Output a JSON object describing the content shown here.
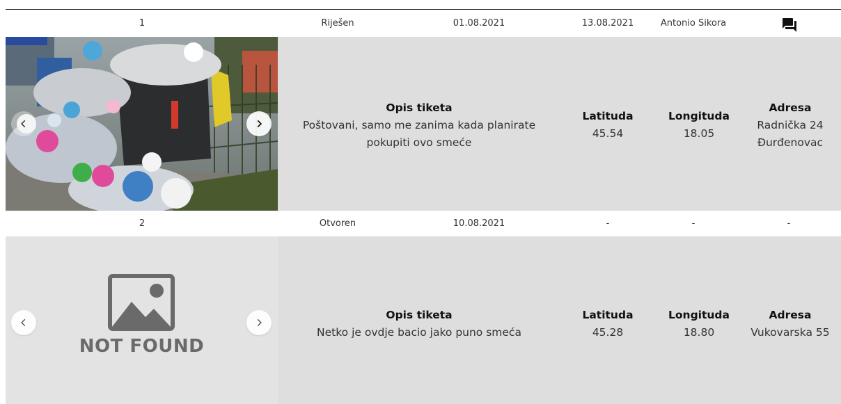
{
  "tickets": [
    {
      "id": "1",
      "status": "Riješen",
      "created": "01.08.2021",
      "resolved": "13.08.2021",
      "assignee": "Antonio Sikora",
      "action_icon": "chat-bubbles-icon",
      "image": "photo-of-overflowing-trash-bins",
      "description_label": "Opis tiketa",
      "description": "Poštovani, samo me zanima kada planirate pokupiti ovo smeće",
      "latitude_label": "Latituda",
      "latitude": "45.54",
      "longitude_label": "Longituda",
      "longitude": "18.05",
      "address_label": "Adresa",
      "address_line1": "Radnička 24",
      "address_line2": "Đurđenovac"
    },
    {
      "id": "2",
      "status": "Otvoren",
      "created": "10.08.2021",
      "resolved": "-",
      "assignee": "-",
      "action": "-",
      "image": "not-found-placeholder",
      "placeholder_text": "NOT FOUND",
      "description_label": "Opis tiketa",
      "description": "Netko je ovdje bacio jako puno smeća",
      "latitude_label": "Latituda",
      "latitude": "45.28",
      "longitude_label": "Longituda",
      "longitude": "18.80",
      "address_label": "Adresa",
      "address_line1": "Vukovarska 55"
    }
  ],
  "colors": {
    "detail_bg": "#dedede",
    "placeholder_bg": "#e3e3e3",
    "placeholder_fg": "#6a6a6a"
  }
}
